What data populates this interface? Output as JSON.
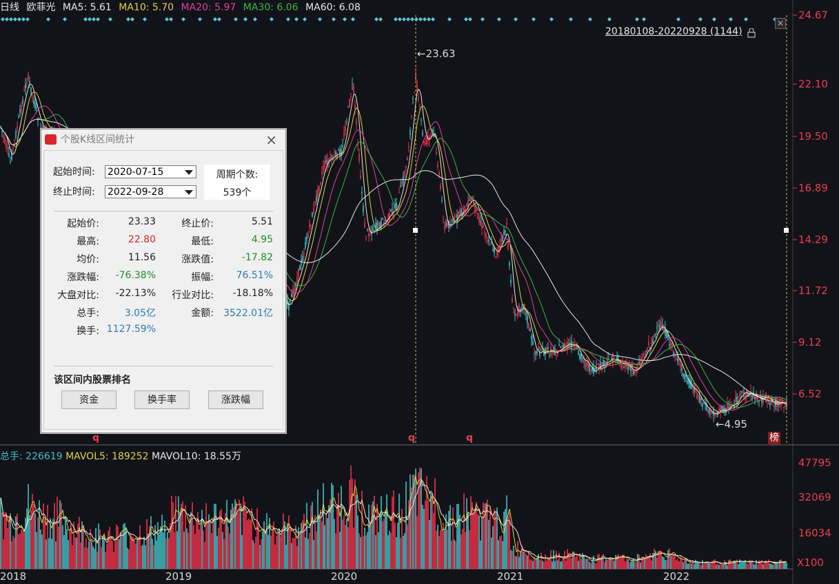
{
  "header": {
    "period": "日线",
    "stock_name": "欧菲光",
    "ma5": "MA5: 5.61",
    "ma10": "MA10: 5.70",
    "ma20": "MA20: 5.97",
    "ma30": "MA30: 6.06",
    "ma60": "MA60: 6.08"
  },
  "colors": {
    "ma5": "#e8e8e8",
    "ma10": "#dfd14a",
    "ma20": "#e040a0",
    "ma30": "#3fb54a",
    "ma60": "#e8e8e8",
    "up": "#f0304a",
    "down": "#3ec2c8",
    "axis_text": "#e93d55"
  },
  "range_label": "20180108-20220928 (1144)",
  "price_axis": [
    "24.67",
    "22.10",
    "19.50",
    "16.89",
    "14.29",
    "11.72",
    "9.12",
    "6.52"
  ],
  "annotations": {
    "high": "23.63",
    "low": "4.95"
  },
  "volume": {
    "title_total": "总手: 226619",
    "title_mavol5": "MAVOL5: 189252",
    "title_mavol10": "MAVOL10: 18.55万",
    "axis": [
      "47795",
      "32069",
      "16034"
    ],
    "unit": "X100"
  },
  "x_axis": [
    "2018",
    "2019",
    "2020",
    "2021",
    "2022"
  ],
  "markers": {
    "q1": "q",
    "q2": "q",
    "q3": "q",
    "bang": "榜"
  },
  "dialog": {
    "title": "个股K线区间统计",
    "start_label": "起始时间:",
    "start_value": "2020-07-15",
    "end_label": "终止时间:",
    "end_value": "2022-09-28",
    "cycle_label": "周期个数:",
    "cycle_value": "539个",
    "stats": [
      {
        "k": "起始价:",
        "v": "23.33",
        "color": "#222222"
      },
      {
        "k": "终止价:",
        "v": "5.51",
        "color": "#222222"
      },
      {
        "k": "最高:",
        "v": "22.80",
        "color": "#e0202e"
      },
      {
        "k": "最低:",
        "v": "4.95",
        "color": "#1e8a2e"
      },
      {
        "k": "均价:",
        "v": "11.56",
        "color": "#222222"
      },
      {
        "k": "涨跌值:",
        "v": "-17.82",
        "color": "#1e8a2e"
      },
      {
        "k": "涨跌幅:",
        "v": "-76.38%",
        "color": "#1e8a2e"
      },
      {
        "k": "振幅:",
        "v": "76.51%",
        "color": "#2a7bb5"
      },
      {
        "k": "大盘对比:",
        "v": "-22.13%",
        "color": "#222222"
      },
      {
        "k": "行业对比:",
        "v": "-18.18%",
        "color": "#222222"
      },
      {
        "k": "总手:",
        "v": "3.05亿",
        "color": "#2a7bb5"
      },
      {
        "k": "金额:",
        "v": "3522.01亿",
        "color": "#2a7bb5"
      },
      {
        "k": "换手:",
        "v": "1127.59%",
        "color": "#2a7bb5"
      }
    ],
    "rank_title": "该区间内股票排名",
    "buttons": [
      "资金",
      "换手率",
      "涨跌幅"
    ]
  }
}
